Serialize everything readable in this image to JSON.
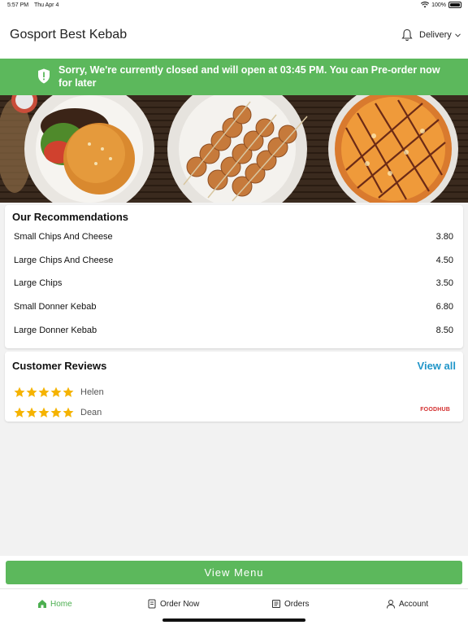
{
  "status_bar": {
    "time": "5:57 PM",
    "date": "Thu Apr 4",
    "battery": "100%"
  },
  "header": {
    "store_name": "Gosport Best Kebab",
    "order_mode": "Delivery"
  },
  "closed_banner": {
    "message": "Sorry, We're currently closed and will open at 03:45 PM. You can Pre-order now for later"
  },
  "recommendations": {
    "title": "Our Recommendations",
    "items": [
      {
        "name": "Small Chips And Cheese",
        "price": "3.80"
      },
      {
        "name": "Large Chips And Cheese",
        "price": "4.50"
      },
      {
        "name": "Large Chips",
        "price": "3.50"
      },
      {
        "name": "Small Donner Kebab",
        "price": "6.80"
      },
      {
        "name": "Large Donner Kebab",
        "price": "8.50"
      }
    ]
  },
  "reviews": {
    "title": "Customer Reviews",
    "view_all": "View all",
    "items": [
      {
        "name": "Helen",
        "rating": 5
      },
      {
        "name": "Dean",
        "rating": 5
      }
    ],
    "brand": "FOODHUB"
  },
  "view_menu_button": "View Menu",
  "tabs": [
    {
      "label": "Home",
      "icon": "home-icon",
      "active": true
    },
    {
      "label": "Order Now",
      "icon": "order-icon",
      "active": false
    },
    {
      "label": "Orders",
      "icon": "receipt-icon",
      "active": false
    },
    {
      "label": "Account",
      "icon": "user-icon",
      "active": false
    }
  ],
  "colors": {
    "accent_green": "#5cb85c",
    "link_blue": "#2196c9",
    "star": "#f5b301"
  }
}
